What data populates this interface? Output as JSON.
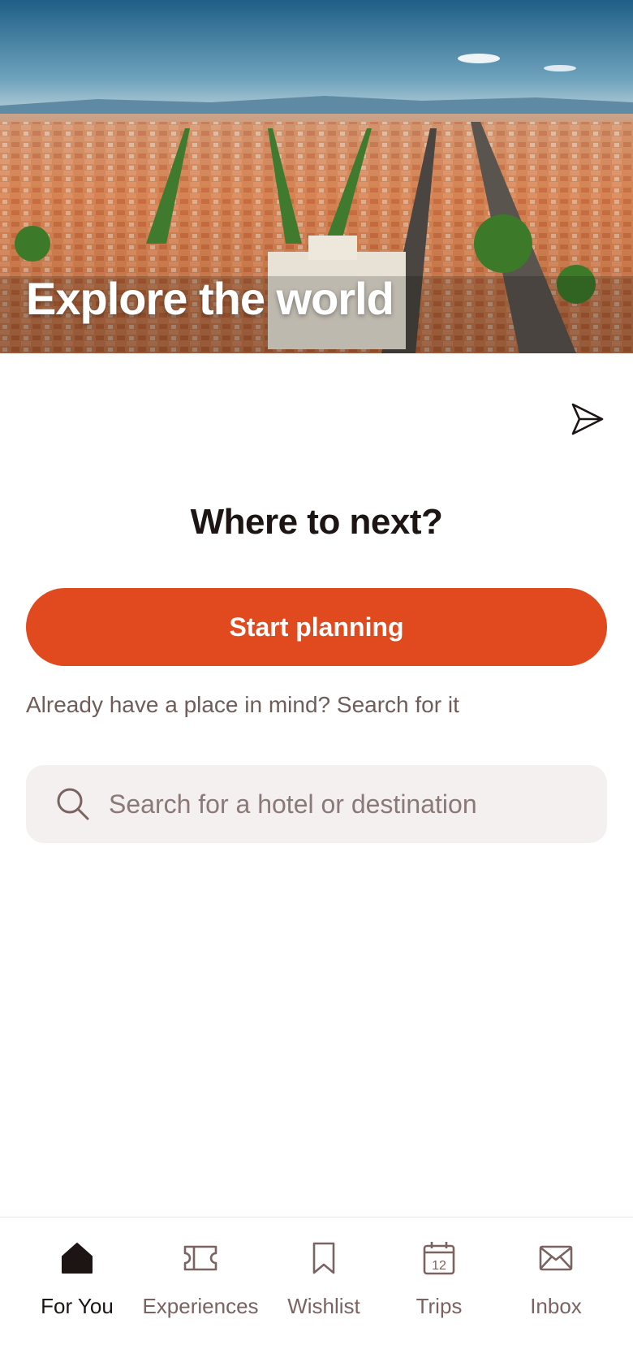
{
  "hero": {
    "title": "Explore the world",
    "image": "aerial-city-photo"
  },
  "share": {
    "icon": "send-icon"
  },
  "main": {
    "heading": "Where to next?",
    "primary_button": "Start planning",
    "hint": "Already have a place in mind? Search for it",
    "search": {
      "placeholder": "Search for a hotel or destination",
      "value": "",
      "icon": "search-icon"
    }
  },
  "nav": {
    "items": [
      {
        "label": "For You",
        "icon": "home-icon",
        "active": true
      },
      {
        "label": "Experiences",
        "icon": "ticket-icon",
        "active": false
      },
      {
        "label": "Wishlist",
        "icon": "bookmark-icon",
        "active": false
      },
      {
        "label": "Trips",
        "icon": "calendar-icon",
        "active": false
      },
      {
        "label": "Inbox",
        "icon": "mail-icon",
        "active": false
      }
    ],
    "calendar_day": "12"
  },
  "colors": {
    "accent": "#e04a1e",
    "text_primary": "#1d1414",
    "text_secondary": "#6f5d5a",
    "search_bg": "#f4f0ef"
  }
}
